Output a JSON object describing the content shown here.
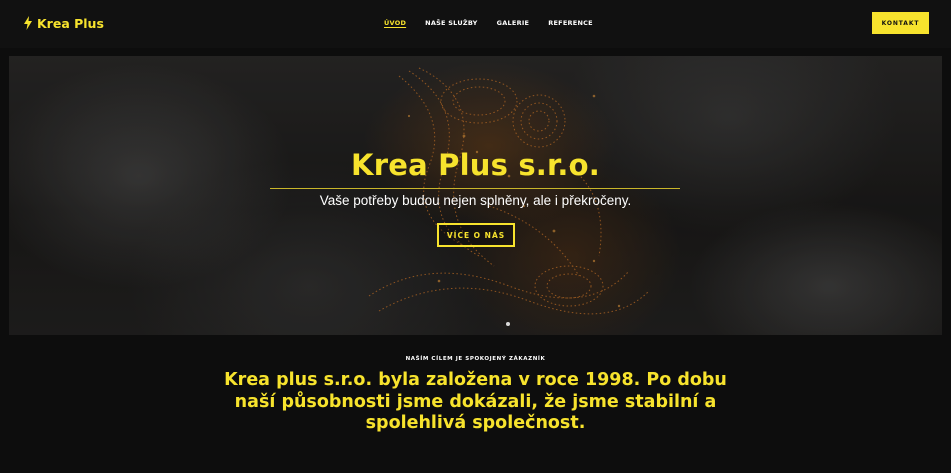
{
  "brand": {
    "name": "Krea Plus",
    "accent": "#f7e32d"
  },
  "nav": {
    "items": [
      {
        "label": "ÚVOD",
        "active": true
      },
      {
        "label": "NAŠE SLUŽBY",
        "active": false
      },
      {
        "label": "GALERIE",
        "active": false
      },
      {
        "label": "REFERENCE",
        "active": false
      }
    ]
  },
  "header": {
    "contact_label": "KONTAKT"
  },
  "hero": {
    "title": "Krea Plus s.r.o.",
    "subtitle": "Vaše potřeby budou nejen splněny, ale i překročeny.",
    "button_label": "VÍCE O NÁS"
  },
  "about": {
    "kicker": "NAŠÍM CÍLEM JE SPOKOJENÝ ZÁKAZNÍK",
    "heading": "Krea plus s.r.o. byla založena v roce 1998. Po dobu naší působnosti jsme dokázali, že jsme stabilní a spolehlivá společnost."
  },
  "icons": {
    "logo": "lightning-bolt-icon"
  }
}
